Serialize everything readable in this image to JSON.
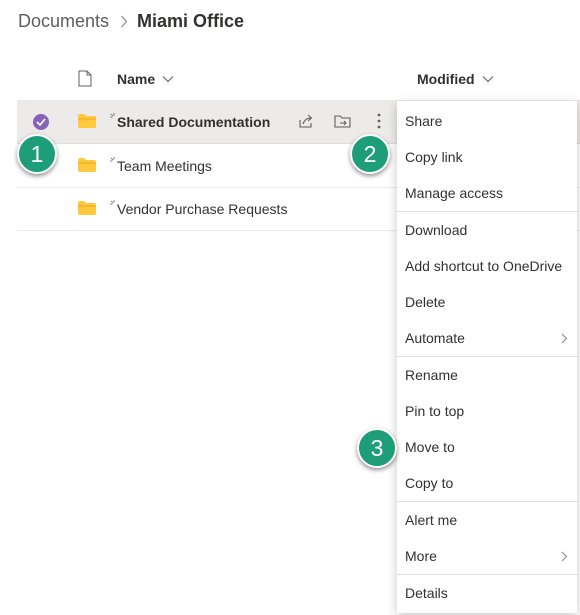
{
  "breadcrumb": {
    "root": "Documents",
    "current": "Miami Office"
  },
  "columns": {
    "name": "Name",
    "modified": "Modified"
  },
  "rows": [
    {
      "name": "Shared Documentation",
      "selected": true
    },
    {
      "name": "Team Meetings",
      "selected": false
    },
    {
      "name": "Vendor Purchase Requests",
      "selected": false
    }
  ],
  "badges": [
    "1",
    "2",
    "3"
  ],
  "menu": {
    "share": "Share",
    "copy_link": "Copy link",
    "manage_access": "Manage access",
    "download": "Download",
    "add_shortcut": "Add shortcut to OneDrive",
    "delete": "Delete",
    "automate": "Automate",
    "rename": "Rename",
    "pin_to_top": "Pin to top",
    "move_to": "Move to",
    "copy_to": "Copy to",
    "alert_me": "Alert me",
    "more": "More",
    "details": "Details"
  },
  "colors": {
    "badge": "#1e9e78",
    "check": "#8764b8",
    "folder": "#ffc83d",
    "selected_row": "#edebe9"
  },
  "icons": [
    "chevron-right-icon",
    "file-type-icon",
    "chevron-down-icon",
    "checkmark-icon",
    "folder-icon",
    "new-item-spark-icon",
    "share-icon",
    "move-folder-icon",
    "more-vertical-icon"
  ]
}
